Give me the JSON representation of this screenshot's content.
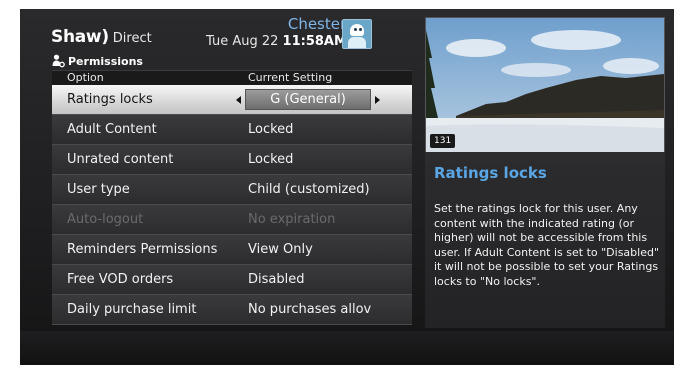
{
  "header": {
    "logo_brand": "Shaw)",
    "logo_suffix": "Direct",
    "user_name": "Chester",
    "date": "Tue Aug 22",
    "time": "11:58AM"
  },
  "section": {
    "title": "Permissions"
  },
  "table": {
    "headers": {
      "option": "Option",
      "setting": "Current Setting"
    },
    "rows": [
      {
        "option": "Ratings locks",
        "setting": "G (General)"
      },
      {
        "option": "Adult Content",
        "setting": "Locked"
      },
      {
        "option": "Unrated content",
        "setting": "Locked"
      },
      {
        "option": "User type",
        "setting": "Child (customized)"
      },
      {
        "option": "Auto-logout",
        "setting": "No expiration"
      },
      {
        "option": "Reminders Permissions",
        "setting": "View Only"
      },
      {
        "option": "Free VOD orders",
        "setting": "Disabled"
      },
      {
        "option": "Daily purchase limit",
        "setting": "No purchases allov"
      }
    ]
  },
  "preview": {
    "channel": "131"
  },
  "info": {
    "title": "Ratings locks",
    "text": "Set the ratings lock for this user. Any content with the indicated rating (or higher) will not be accessible from this user. If Adult Content is set to \"Disabled\" it will not be possible to set your Ratings locks to \"No locks\"."
  },
  "colors": {
    "accent_blue": "#5aa6e4",
    "user_name_blue": "#7fb6e8",
    "selected_row": "#d9d9d9",
    "disabled_text": "#6a6a6c"
  }
}
